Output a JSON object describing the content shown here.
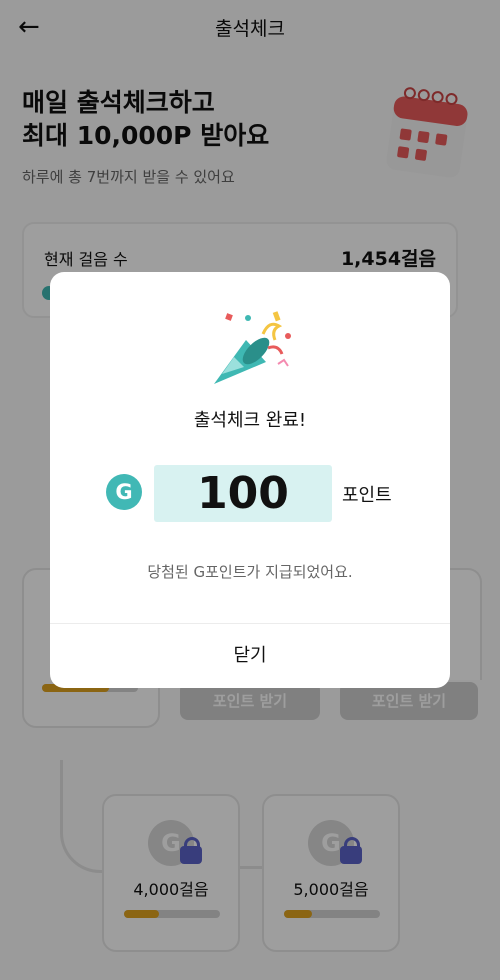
{
  "header": {
    "title": "출석체크",
    "back_icon": "arrow-left-icon"
  },
  "hero": {
    "title_line1": "매일 출석체크하고",
    "title_line2": "최대 10,000P 받아요",
    "subtitle": "하루에 총 7번까지 받을 수 있어요",
    "illustration": "calendar-icon"
  },
  "steps_card": {
    "label": "현재 걸음 수",
    "value": "1,454걸음"
  },
  "reward_buttons": [
    "포인트 받기",
    "포인트 받기"
  ],
  "milestones": [
    {
      "label": "4,000걸음",
      "icon": "g-point-icon",
      "locked": true,
      "progress": 0.36
    },
    {
      "label": "5,000걸음",
      "icon": "g-point-icon",
      "locked": true,
      "progress": 0.29
    }
  ],
  "dialog": {
    "illustration": "party-popper-icon",
    "title": "출석체크 완료!",
    "badge_letter": "G",
    "points_value": "100",
    "points_unit": "포인트",
    "message": "당첨된 G포인트가 지급되었어요.",
    "close_label": "닫기"
  },
  "colors": {
    "accent_teal": "#41b8b5",
    "points_bg": "#d8f2f1",
    "progress": "#e1a420",
    "lock": "#5b63c9"
  }
}
